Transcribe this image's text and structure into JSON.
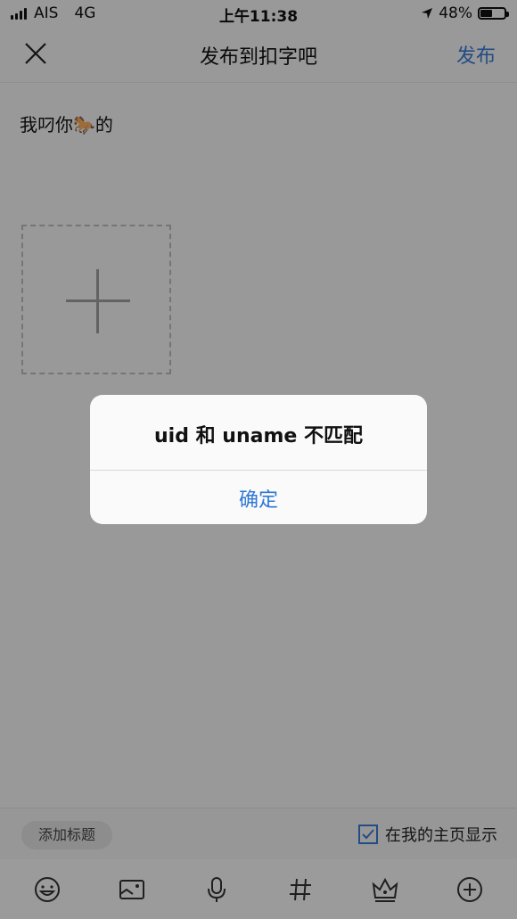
{
  "status_bar": {
    "carrier": "AIS",
    "network": "4G",
    "time": "上午11:38",
    "battery": "48%"
  },
  "nav": {
    "title": "发布到扣字吧",
    "publish_label": "发布"
  },
  "post": {
    "text": "我叼你🐎的"
  },
  "bottom_bar": {
    "add_title_label": "添加标题",
    "show_home_label": "在我的主页显示",
    "show_home_checked": true
  },
  "toolbar": {
    "icons": [
      "emoji-icon",
      "image-icon",
      "mic-icon",
      "hashtag-icon",
      "crown-icon",
      "plus-circle-icon"
    ]
  },
  "dialog": {
    "message": "uid 和 uname 不匹配",
    "confirm_label": "确定"
  },
  "colors": {
    "accent": "#3a7bd5",
    "dialog_button": "#2f78d6"
  }
}
